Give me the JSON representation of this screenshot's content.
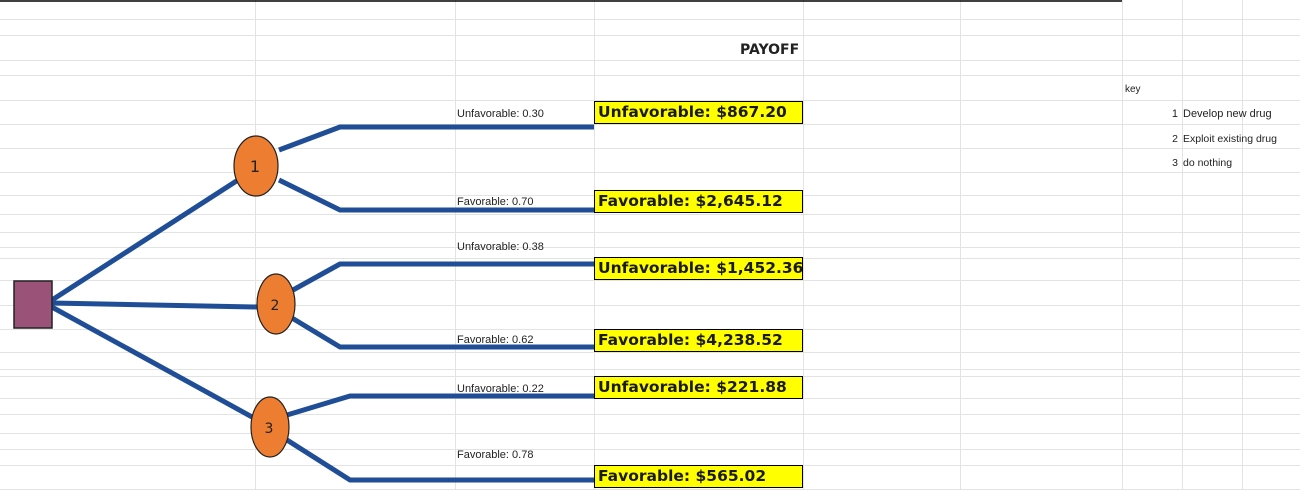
{
  "sheet": {
    "title": "PAYOFF",
    "key_label": "key",
    "key_items": [
      {
        "num": "1",
        "text": "Develop new drug"
      },
      {
        "num": "2",
        "text": "Exploit existing drug"
      },
      {
        "num": "3",
        "text": "do nothing"
      }
    ]
  },
  "tree": {
    "decision_color": "#9b5278",
    "chance_color": "#ed7d31",
    "branch_color": "#1f4e96",
    "payoff_fill": "#ffff00",
    "chance_nodes": [
      {
        "label": "1"
      },
      {
        "label": "2"
      },
      {
        "label": "3"
      }
    ],
    "outcomes": [
      {
        "prob_label": "Unfavorable: 0.30",
        "payoff": "Unfavorable: $867.20"
      },
      {
        "prob_label": "Favorable: 0.70",
        "payoff": "Favorable: $2,645.12"
      },
      {
        "prob_label": "Unfavorable: 0.38",
        "payoff": "Unfavorable: $1,452.36"
      },
      {
        "prob_label": "Favorable: 0.62",
        "payoff": "Favorable: $4,238.52"
      },
      {
        "prob_label": "Unfavorable: 0.22",
        "payoff": "Unfavorable: $221.88"
      },
      {
        "prob_label": "Favorable: 0.78",
        "payoff": "Favorable: $565.02"
      }
    ]
  }
}
